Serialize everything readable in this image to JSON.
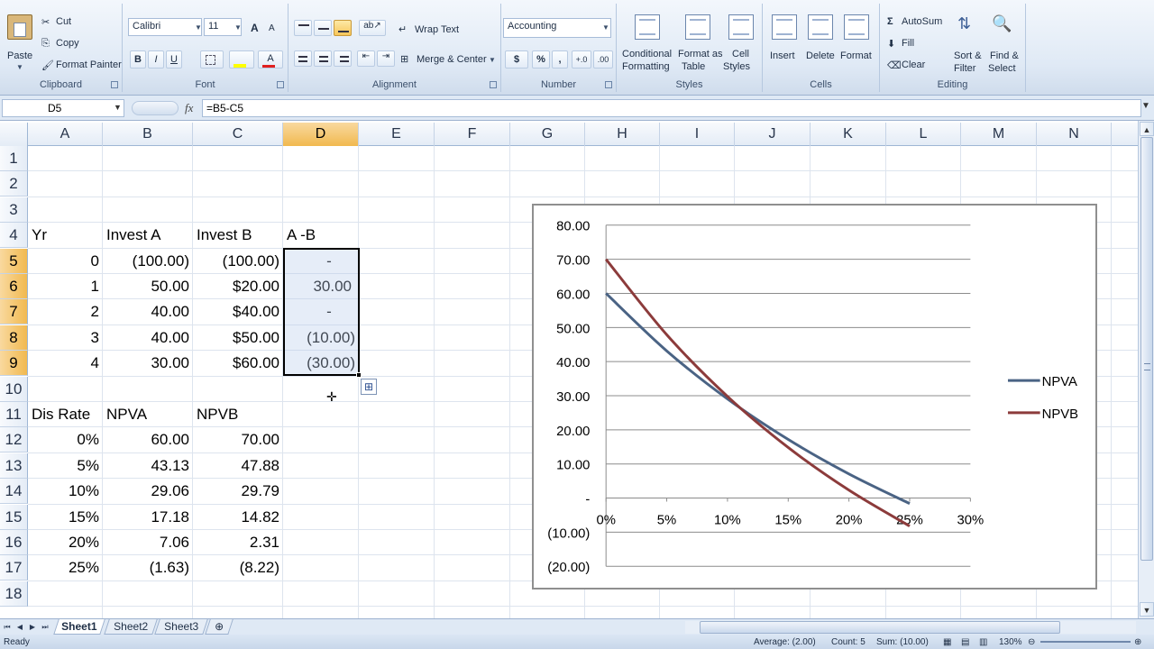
{
  "ribbon": {
    "clipboard": {
      "label": "Clipboard",
      "paste": "Paste",
      "cut": "Cut",
      "copy": "Copy",
      "format_painter": "Format Painter"
    },
    "font": {
      "label": "Font",
      "name": "Calibri",
      "size": "11",
      "bold": "B",
      "italic": "I",
      "underline": "U",
      "font_color_letter": "A",
      "grow": "A",
      "shrink": "A"
    },
    "alignment": {
      "label": "Alignment",
      "wrap_text": "Wrap Text",
      "merge_center": "Merge & Center"
    },
    "number": {
      "label": "Number",
      "format": "Accounting",
      "currency": "$",
      "percent": "%",
      "comma": ",",
      "inc_decimal": "+.0",
      "dec_decimal": ".00"
    },
    "styles": {
      "label": "Styles",
      "conditional": "Conditional",
      "conditional2": "Formatting",
      "format_as": "Format as",
      "format_as2": "Table",
      "cell": "Cell",
      "cell2": "Styles"
    },
    "cells": {
      "label": "Cells",
      "insert": "Insert",
      "delete": "Delete",
      "format": "Format"
    },
    "editing": {
      "label": "Editing",
      "autosum": "AutoSum",
      "fill": "Fill",
      "clear": "Clear",
      "sort": "Sort &",
      "sort2": "Filter",
      "find": "Find &",
      "find2": "Select"
    }
  },
  "formula_bar": {
    "name_box": "D5",
    "fx": "fx",
    "formula": "=B5-C5"
  },
  "columns": [
    "A",
    "B",
    "C",
    "D",
    "E",
    "F",
    "G",
    "H",
    "I",
    "J",
    "K",
    "L",
    "M",
    "N"
  ],
  "selected_column": "D",
  "rows": [
    "1",
    "2",
    "3",
    "4",
    "5",
    "6",
    "7",
    "8",
    "9",
    "10",
    "11",
    "12",
    "13",
    "14",
    "15",
    "16",
    "17",
    "18"
  ],
  "selected_rows": [
    "5",
    "6",
    "7",
    "8",
    "9"
  ],
  "cells": {
    "A4": "Yr",
    "B4": "Invest A",
    "C4": "Invest B",
    "D4": "A -B",
    "A5": "0",
    "B5": "(100.00)",
    "C5": "(100.00)",
    "D5": "-",
    "A6": "1",
    "B6": "50.00",
    "C6": "$20.00",
    "D6": "30.00",
    "A7": "2",
    "B7": "40.00",
    "C7": "$40.00",
    "D7": "-",
    "A8": "3",
    "B8": "40.00",
    "C8": "$50.00",
    "D8": "(10.00)",
    "A9": "4",
    "B9": "30.00",
    "C9": "$60.00",
    "D9": "(30.00)",
    "A11": "Dis Rate",
    "B11": "NPVA",
    "C11": "NPVB",
    "A12": "0%",
    "B12": "60.00",
    "C12": "70.00",
    "A13": "5%",
    "B13": "43.13",
    "C13": "47.88",
    "A14": "10%",
    "B14": "29.06",
    "C14": "29.79",
    "A15": "15%",
    "B15": "17.18",
    "C15": "14.82",
    "A16": "20%",
    "B16": "7.06",
    "C16": "2.31",
    "A17": "25%",
    "B17": "(1.63)",
    "C17": "(8.22)"
  },
  "chart_data": {
    "type": "line",
    "x": [
      0,
      0.05,
      0.1,
      0.15,
      0.2,
      0.25
    ],
    "series": [
      {
        "name": "NPVA",
        "values": [
          60.0,
          43.13,
          29.06,
          17.18,
          7.06,
          -1.63
        ],
        "color": "#4a6384"
      },
      {
        "name": "NPVB",
        "values": [
          70.0,
          47.88,
          29.79,
          14.82,
          2.31,
          -8.22
        ],
        "color": "#8c3b3b"
      }
    ],
    "y_ticks": [
      "80.00",
      "70.00",
      "60.00",
      "50.00",
      "40.00",
      "30.00",
      "20.00",
      "10.00",
      "-",
      "(10.00)",
      "(20.00)"
    ],
    "x_ticks": [
      "0%",
      "5%",
      "10%",
      "15%",
      "20%",
      "25%",
      "30%"
    ],
    "ylim": [
      -20,
      80
    ],
    "xlim": [
      0,
      0.3
    ],
    "grid": true,
    "legend": "right"
  },
  "sheets": [
    "Sheet1",
    "Sheet2",
    "Sheet3"
  ],
  "active_sheet": "Sheet1",
  "status": {
    "mode": "Ready",
    "average": "Average: (2.00)",
    "count": "Count: 5",
    "sum": "Sum: (10.00)",
    "zoom": "130%"
  }
}
